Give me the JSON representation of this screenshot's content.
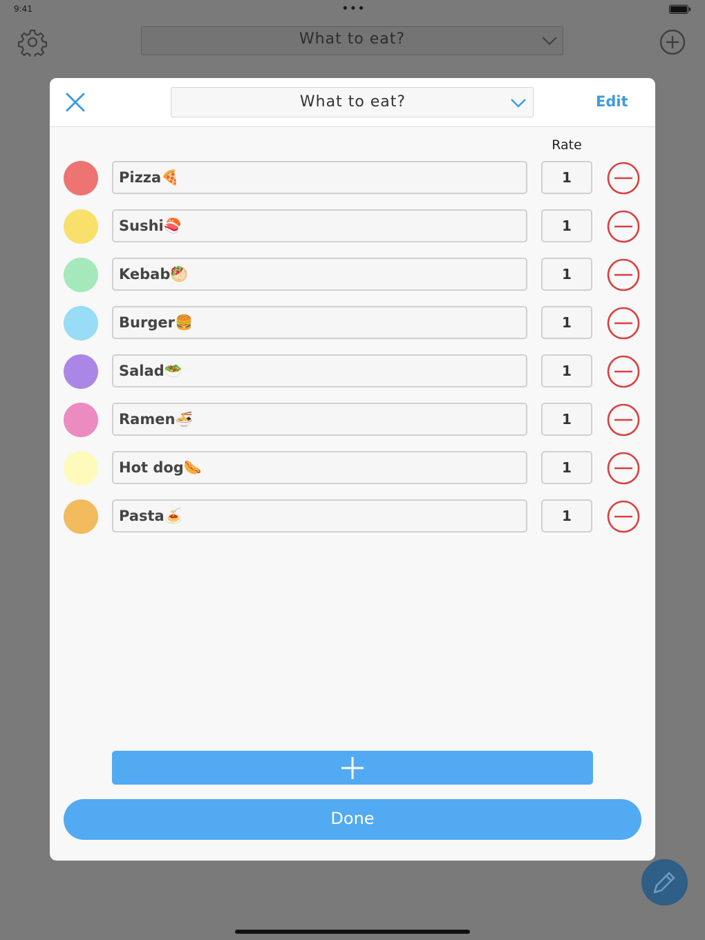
{
  "status_bar": {
    "time": "9:41",
    "dots": "•••"
  },
  "background_header": {
    "title": "What to eat?",
    "settings_icon": "gear-icon",
    "add_icon": "plus-circle-icon"
  },
  "modal": {
    "close_icon": "close-icon",
    "title": "What to eat?",
    "edit_label": "Edit",
    "rate_header": "Rate",
    "items": [
      {
        "name": "Pizza🍕",
        "rate": "1",
        "color": "#ee7373"
      },
      {
        "name": "Sushi🍣",
        "rate": "1",
        "color": "#f8e06a"
      },
      {
        "name": "Kebab🥙",
        "rate": "1",
        "color": "#a5e8b9"
      },
      {
        "name": "Burger🍔",
        "rate": "1",
        "color": "#98dcf6"
      },
      {
        "name": "Salad🥗",
        "rate": "1",
        "color": "#aa86e6"
      },
      {
        "name": "Ramen🍜",
        "rate": "1",
        "color": "#eb8bc0"
      },
      {
        "name": "Hot dog🌭",
        "rate": "1",
        "color": "#fdfabc"
      },
      {
        "name": "Pasta🍝",
        "rate": "1",
        "color": "#f1bb5e"
      }
    ],
    "add_icon": "plus-icon",
    "done_label": "Done"
  },
  "fab": {
    "icon": "pencil-icon"
  },
  "colors": {
    "accent": "#52aaf2",
    "remove": "#d9413f",
    "edit_text": "#3d9be0"
  }
}
